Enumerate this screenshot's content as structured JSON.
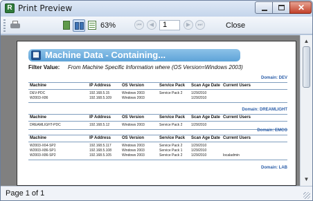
{
  "window": {
    "title": "Print Preview",
    "app_icon": "crystal-reports-icon"
  },
  "toolbar": {
    "zoom": "63%",
    "page_number": "1",
    "close_label": "Close",
    "nav": {
      "first": "⏮",
      "prev": "◀",
      "next": "▶",
      "last": "⏭"
    }
  },
  "status": {
    "text": "Page 1 of 1"
  },
  "report": {
    "logo_glyph": "▦",
    "title": "Machine Data - Containing...",
    "filter_label": "Filter Value:",
    "filter_value": "From Machine Specific Information where (OS Version=Windows 2003)",
    "columns": [
      "Machine",
      "IP Address",
      "OS Version",
      "Service Pack",
      "Scan Age Date",
      "Current Users"
    ],
    "groups": [
      {
        "domain": "Domain: DEV",
        "rows": [
          [
            "DEV-PDC",
            "192.168.5.15",
            "Windows 2003",
            "Service Pack 2",
            "1/29/2010",
            ""
          ],
          [
            "W2003-X86",
            "192.168.5.109",
            "Windows 2003",
            "",
            "1/29/2010",
            ""
          ]
        ]
      },
      {
        "domain": "Domain: DREAMLIGHT",
        "rows": [
          [
            "DREAMLIGHT-PDC",
            "192.168.5.12",
            "Windows 2003",
            "Service Pack 2",
            "1/29/2010",
            ""
          ]
        ]
      },
      {
        "domain": "Domain: EMCO",
        "rows": [
          [
            "W2003-X64-SP2",
            "192.168.5.117",
            "Windows 2003",
            "Service Pack 2",
            "1/29/2010",
            ""
          ],
          [
            "W2003-X86-SP1",
            "192.168.5.108",
            "Windows 2003",
            "Service Pack 1",
            "1/29/2010",
            ""
          ],
          [
            "W2003-X86-SP2",
            "192.168.5.105",
            "Windows 2003",
            "Service Pack 2",
            "1/29/2010",
            "localadmin"
          ]
        ]
      },
      {
        "domain": "Domain: LAB",
        "rows": []
      }
    ]
  },
  "colors": {
    "banner": "#6fb0e0",
    "domain_text": "#2a5da8",
    "preview_bg": "#808080"
  }
}
